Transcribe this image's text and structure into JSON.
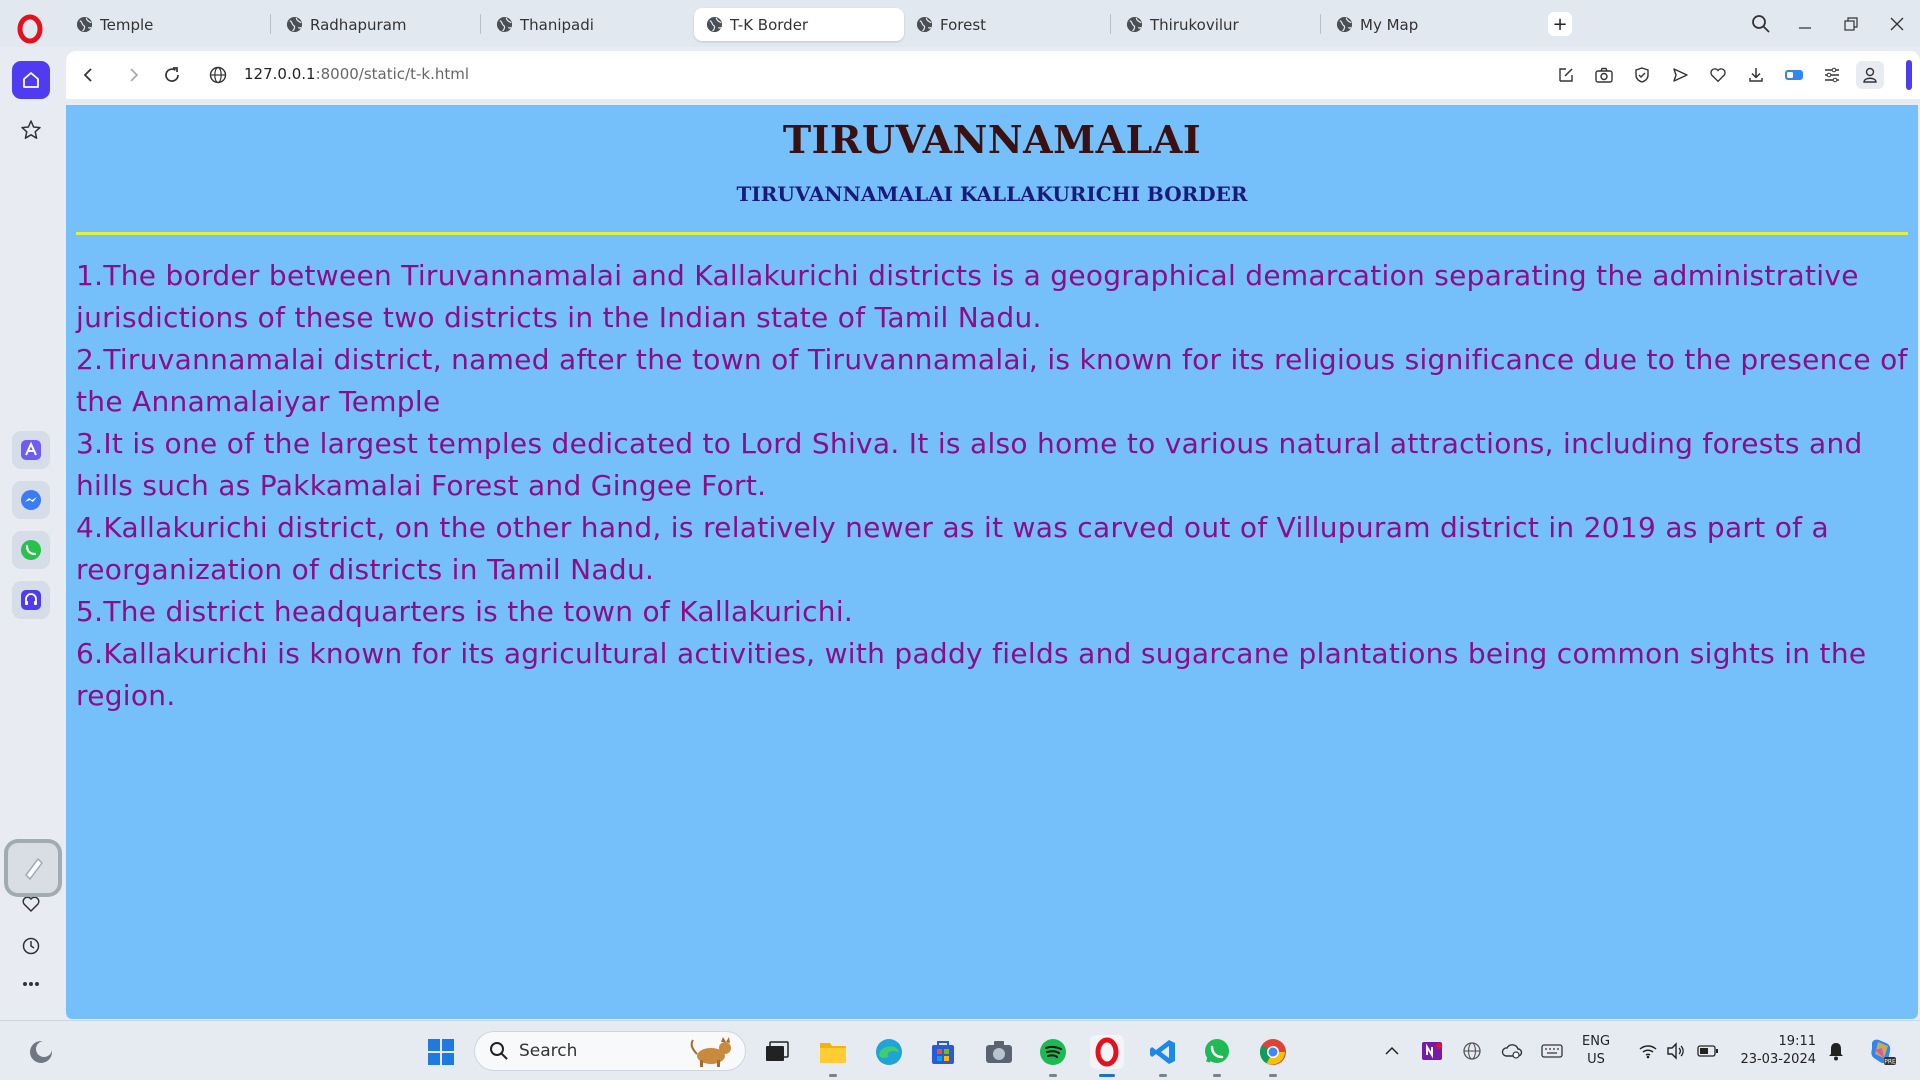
{
  "tabs": [
    {
      "title": "Temple",
      "active": false
    },
    {
      "title": "Radhapuram",
      "active": false
    },
    {
      "title": "Thanipadi",
      "active": false
    },
    {
      "title": "T-K Border",
      "active": true
    },
    {
      "title": "Forest",
      "active": false
    },
    {
      "title": "Thirukovilur",
      "active": false
    },
    {
      "title": "My Map",
      "active": false
    }
  ],
  "address": {
    "host": "127.0.0.1",
    "rest": ":8000/static/t-k.html"
  },
  "page": {
    "heading": "TIRUVANNAMALAI",
    "subheading": "TIRUVANNAMALAI KALLAKURICHI BORDER",
    "points": [
      "1.The border between Tiruvannamalai and Kallakurichi districts is a geographical demarcation separating the administrative jurisdictions of these two districts in the Indian state of Tamil Nadu.",
      "2.Tiruvannamalai district, named after the town of Tiruvannamalai, is known for its religious significance due to the presence of the Annamalaiyar Temple",
      "3.It is one of the largest temples dedicated to Lord Shiva. It is also home to various natural attractions, including forests and hills such as Pakkamalai Forest and Gingee Fort.",
      "4.Kallakurichi district, on the other hand, is relatively newer as it was carved out of Villupuram district in 2019 as part of a reorganization of districts in Tamil Nadu.",
      "5.The district headquarters is the town of Kallakurichi.",
      "6.Kallakurichi is known for its agricultural activities, with paddy fields and sugarcane plantations being common sights in the region."
    ]
  },
  "taskbar": {
    "search_placeholder": "Search",
    "language": "ENG",
    "region": "US",
    "time": "19:11",
    "date": "23-03-2024"
  },
  "colors": {
    "page_bg": "#75bffa",
    "heading": "#3a1010",
    "subheading": "#1a1a7a",
    "rule": "#d9f24a",
    "body_text": "#8a0e86",
    "accent": "#4f3cf0"
  }
}
